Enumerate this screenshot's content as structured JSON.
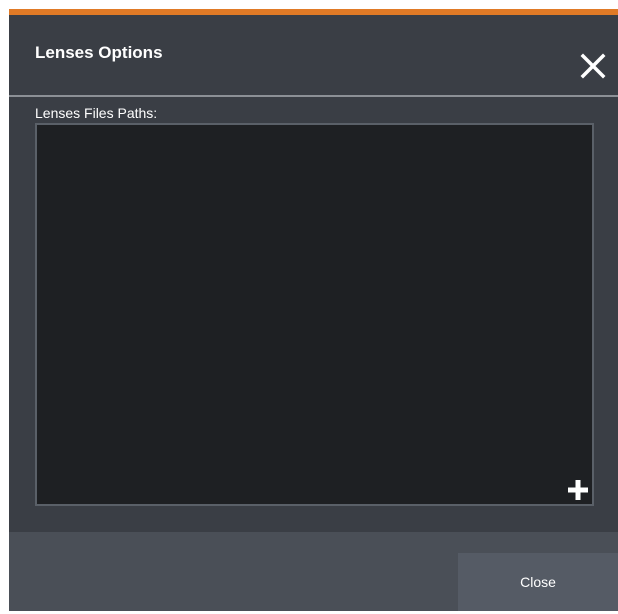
{
  "dialog": {
    "title": "Lenses Options",
    "accent_color": "#e07a26",
    "close_icon": "close-icon"
  },
  "paths": {
    "label": "Lenses Files Paths:",
    "items": [],
    "add_icon": "plus-icon"
  },
  "footer": {
    "close_label": "Close"
  }
}
